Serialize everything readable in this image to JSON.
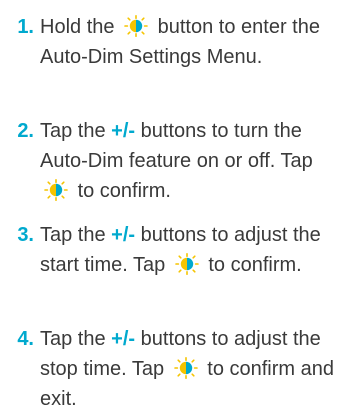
{
  "steps": [
    {
      "number": "1.",
      "before": "Hold the",
      "after": "button to enter the Auto-Dim Settings Menu."
    },
    {
      "number": "2.",
      "before": "Tap the",
      "pm": "+/-",
      "middle": "buttons to turn the Auto-Dim feature on or off. Tap",
      "after": "to confirm."
    },
    {
      "number": "3.",
      "before": "Tap the",
      "pm": "+/-",
      "middle": "buttons to adjust the start time. Tap",
      "after": "to confirm."
    },
    {
      "number": "4.",
      "before": "Tap the",
      "pm": "+/-",
      "middle": "buttons to adjust the stop time. Tap",
      "after": "to confirm and exit."
    }
  ],
  "icon": "brightness-icon",
  "colors": {
    "accent": "#00a9ce",
    "text": "#3a3a3a"
  }
}
